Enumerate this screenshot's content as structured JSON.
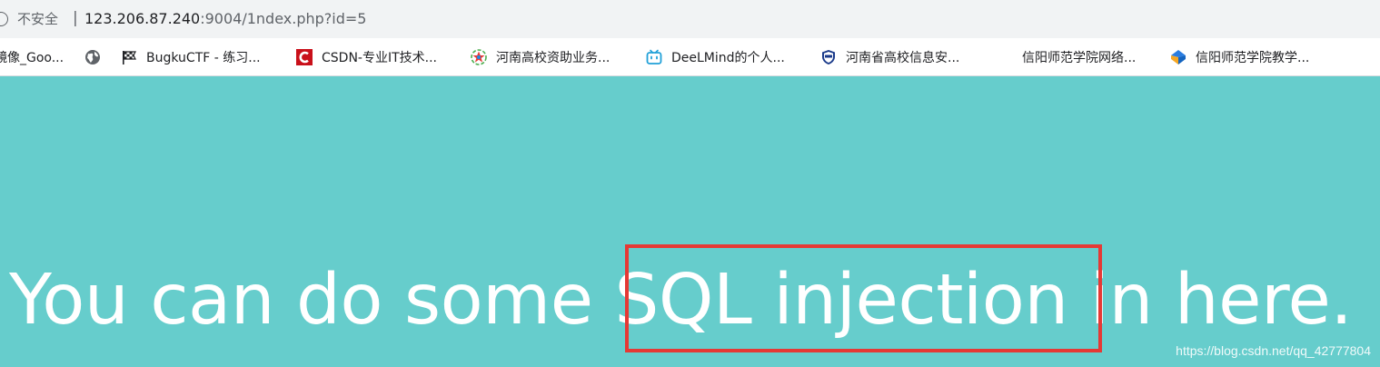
{
  "addressbar": {
    "security_label": "不安全",
    "separator": "|",
    "url_host": "123.206.87.240",
    "url_rest": ":9004/1ndex.php?id=5"
  },
  "bookmarks": [
    {
      "label": "镜像_Goo...",
      "icon": "none"
    },
    {
      "label": "",
      "icon": "globe-icon"
    },
    {
      "label": "BugkuCTF - 练习...",
      "icon": "checkered-flag-icon"
    },
    {
      "label": "CSDN-专业IT技术...",
      "icon": "csdn-logo-icon"
    },
    {
      "label": "河南高校资助业务...",
      "icon": "star-emblem-icon"
    },
    {
      "label": "DeeLMind的个人...",
      "icon": "bilibili-tv-icon"
    },
    {
      "label": "河南省高校信息安...",
      "icon": "shield-badge-icon"
    },
    {
      "label": "信阳师范学院网络...",
      "icon": "none"
    },
    {
      "label": "信阳师范学院教学...",
      "icon": "diamond-logo-icon"
    }
  ],
  "content": {
    "headline": "You can do some SQL injection in here.",
    "watermark": "https://blog.csdn.net/qq_42777804"
  },
  "colors": {
    "page_background": "#66cdcc",
    "highlight_border": "#e53935",
    "headline_text": "#ffffff"
  }
}
